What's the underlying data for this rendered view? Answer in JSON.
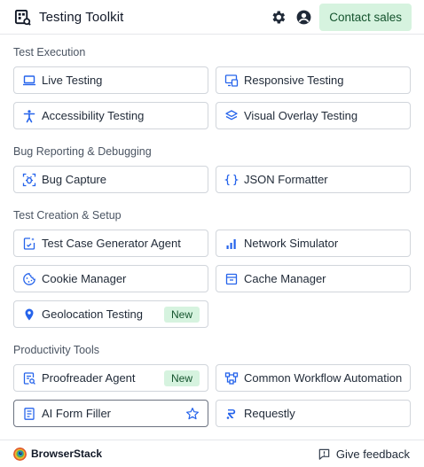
{
  "header": {
    "title": "Testing Toolkit",
    "contact_label": "Contact sales",
    "icons": [
      "toolkit-logo-icon",
      "gear-icon",
      "user-circle-icon"
    ]
  },
  "sections": [
    {
      "title": "Test Execution",
      "items": [
        {
          "label": "Live Testing",
          "icon": "laptop-icon"
        },
        {
          "label": "Responsive Testing",
          "icon": "responsive-screens-icon"
        },
        {
          "label": "Accessibility Testing",
          "icon": "accessibility-person-icon"
        },
        {
          "label": "Visual Overlay Testing",
          "icon": "layers-icon"
        }
      ]
    },
    {
      "title": "Bug Reporting & Debugging",
      "items": [
        {
          "label": "Bug Capture",
          "icon": "bug-capture-icon"
        },
        {
          "label": "JSON Formatter",
          "icon": "curly-braces-icon"
        }
      ]
    },
    {
      "title": "Test Creation & Setup",
      "items": [
        {
          "label": "Test Case Generator Agent",
          "icon": "test-case-generator-icon"
        },
        {
          "label": "Network Simulator",
          "icon": "signal-bars-icon"
        },
        {
          "label": "Cookie Manager",
          "icon": "cookie-icon"
        },
        {
          "label": "Cache Manager",
          "icon": "cache-box-icon"
        },
        {
          "label": "Geolocation Testing",
          "icon": "location-pin-icon",
          "badge": "New"
        }
      ]
    },
    {
      "title": "Productivity Tools",
      "items": [
        {
          "label": "Proofreader Agent",
          "icon": "proofreader-icon",
          "badge": "New"
        },
        {
          "label": "Common Workflow Automation",
          "icon": "workflow-icon"
        },
        {
          "label": "AI Form Filler",
          "icon": "form-document-icon",
          "favorite_icon": "star-icon"
        },
        {
          "label": "Requestly",
          "icon": "requestly-icon"
        }
      ]
    }
  ],
  "footer": {
    "brand": "BrowserStack",
    "feedback_label": "Give feedback"
  },
  "colors": {
    "accent_blue": "#2563eb",
    "badge_bg": "#d6f3df",
    "badge_text": "#14532d"
  }
}
